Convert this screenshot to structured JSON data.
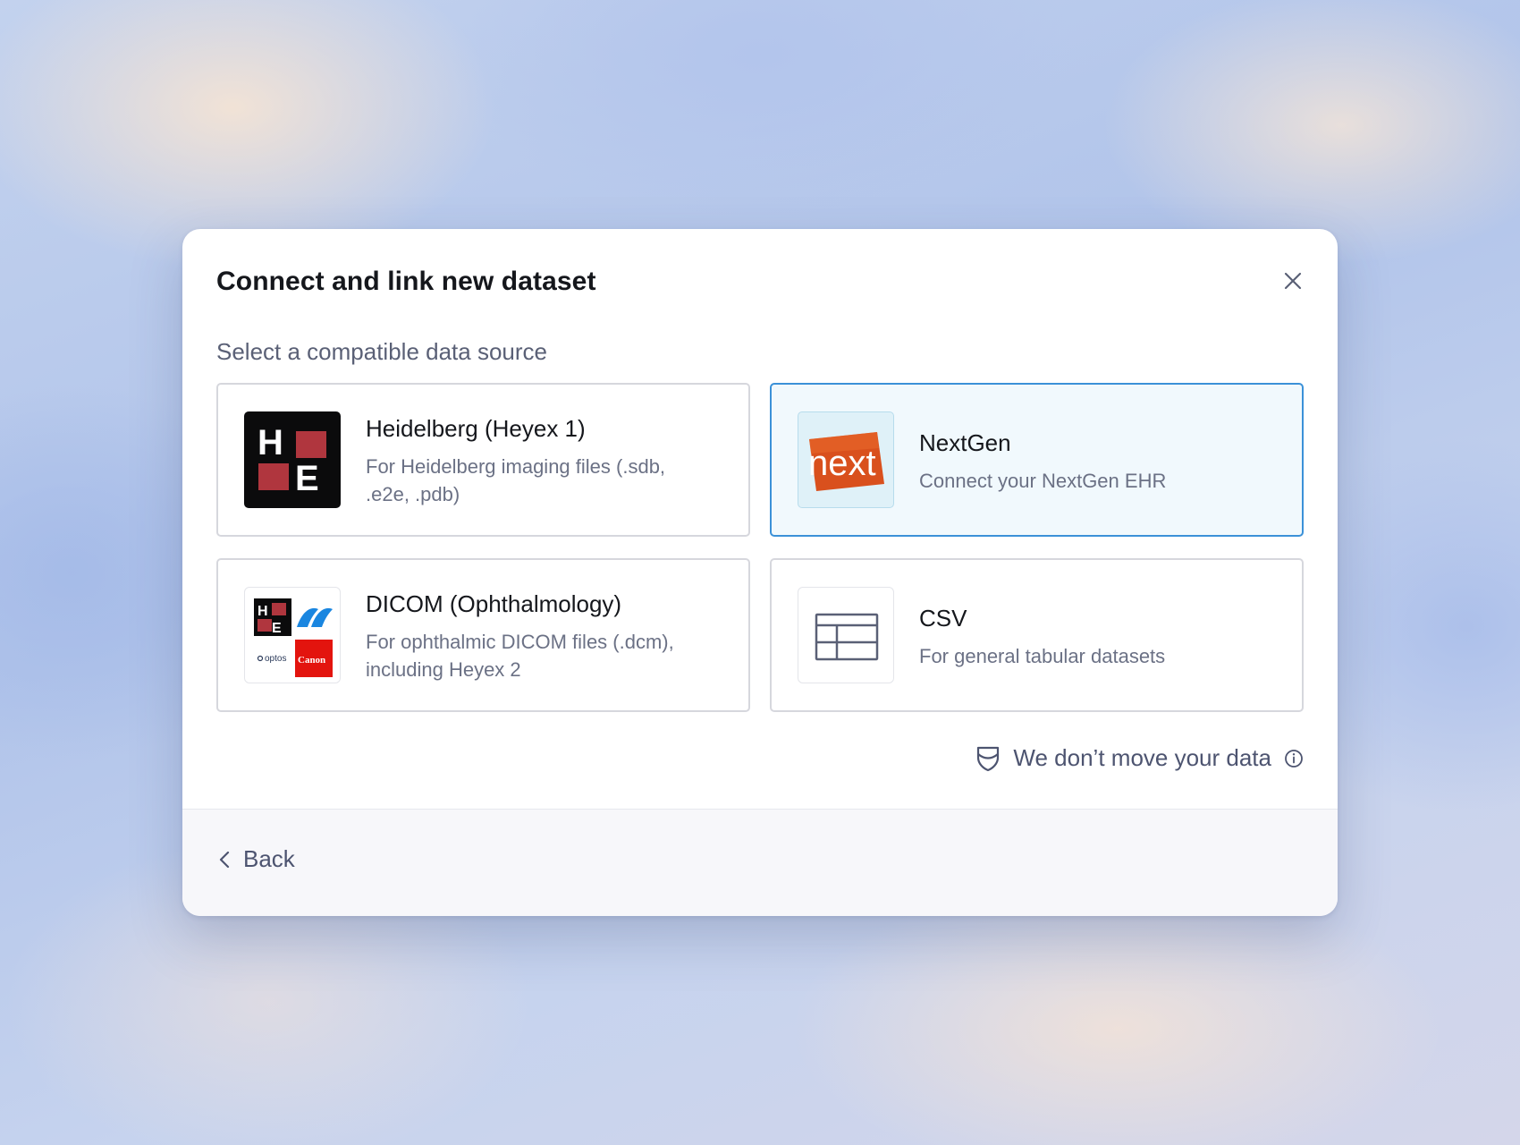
{
  "dialog": {
    "title": "Connect and link new dataset",
    "subtitle": "Select a compatible data source",
    "close_icon": "close-icon"
  },
  "sources": [
    {
      "id": "heidelberg",
      "title": "Heidelberg (Heyex 1)",
      "description": "For Heidelberg imaging files (.sdb, .e2e, .pdb)",
      "logo_text": [
        "H",
        "E"
      ],
      "selected": false
    },
    {
      "id": "nextgen",
      "title": "NextGen",
      "description": "Connect your NextGen EHR",
      "logo_text": "next",
      "selected": true
    },
    {
      "id": "dicom",
      "title": "DICOM (Ophthalmology)",
      "description": "For ophthalmic DICOM files (.dcm), including Heyex 2",
      "logo_text": [
        "H",
        "E",
        "optos",
        "Canon"
      ],
      "selected": false
    },
    {
      "id": "csv",
      "title": "CSV",
      "description": "For general tabular datasets",
      "icon": "table-icon",
      "selected": false
    }
  ],
  "privacy": {
    "text": "We don’t move your data",
    "icons": [
      "shield-icon",
      "info-icon"
    ]
  },
  "footer": {
    "back_label": "Back",
    "back_icon": "chevron-left-icon"
  },
  "colors": {
    "selected_border": "#3b91d8",
    "selected_bg": "#f1f9fd",
    "heidelberg_red": "#b0363e",
    "nextgen_orange": "#d9501d",
    "canon_red": "#e3140e"
  }
}
